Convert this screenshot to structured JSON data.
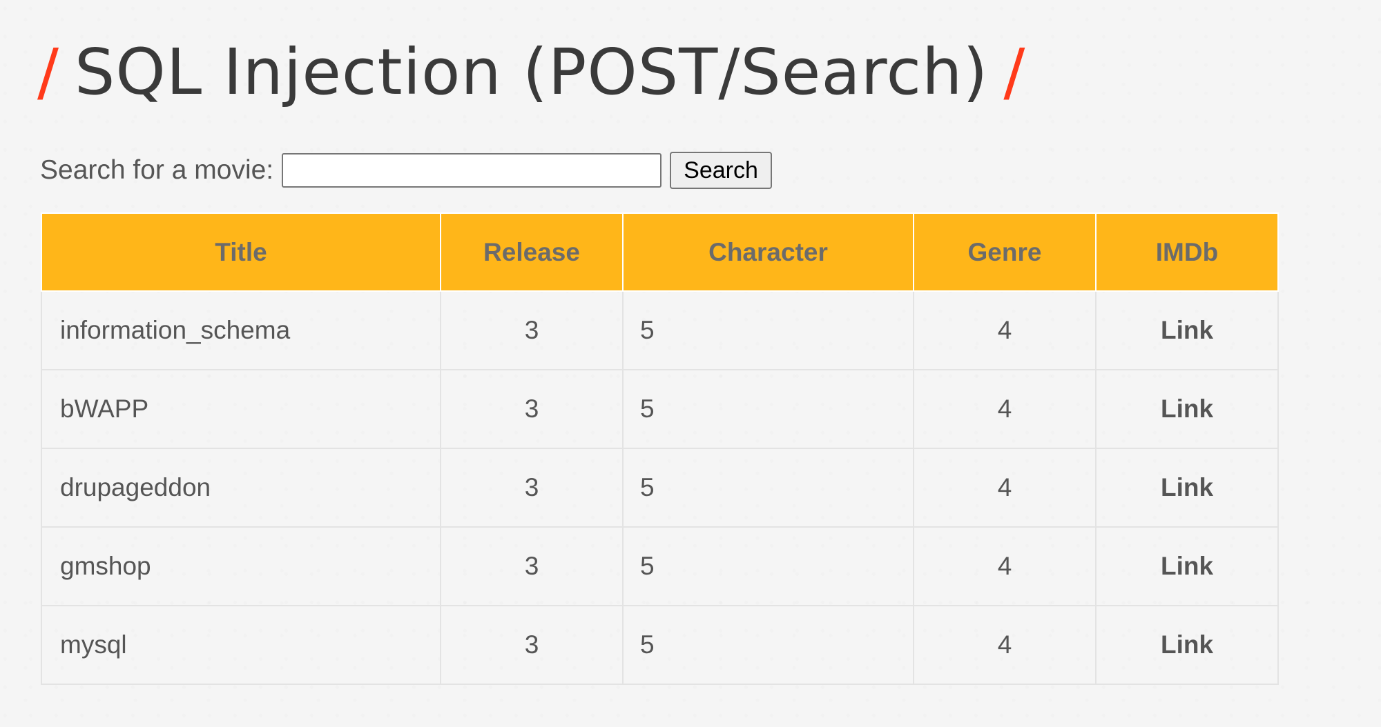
{
  "page": {
    "title": "SQL Injection (POST/Search)",
    "title_decoration": "/",
    "accent_color": "#ff3a1a",
    "header_color": "#ffb619"
  },
  "search": {
    "label": "Search for a movie:",
    "value": "",
    "placeholder": "",
    "button_label": "Search"
  },
  "table": {
    "columns": [
      "Title",
      "Release",
      "Character",
      "Genre",
      "IMDb"
    ],
    "rows": [
      {
        "title": "information_schema",
        "release": "3",
        "character": "5",
        "genre": "4",
        "imdb": "Link"
      },
      {
        "title": "bWAPP",
        "release": "3",
        "character": "5",
        "genre": "4",
        "imdb": "Link"
      },
      {
        "title": "drupageddon",
        "release": "3",
        "character": "5",
        "genre": "4",
        "imdb": "Link"
      },
      {
        "title": "gmshop",
        "release": "3",
        "character": "5",
        "genre": "4",
        "imdb": "Link"
      },
      {
        "title": "mysql",
        "release": "3",
        "character": "5",
        "genre": "4",
        "imdb": "Link"
      }
    ]
  }
}
